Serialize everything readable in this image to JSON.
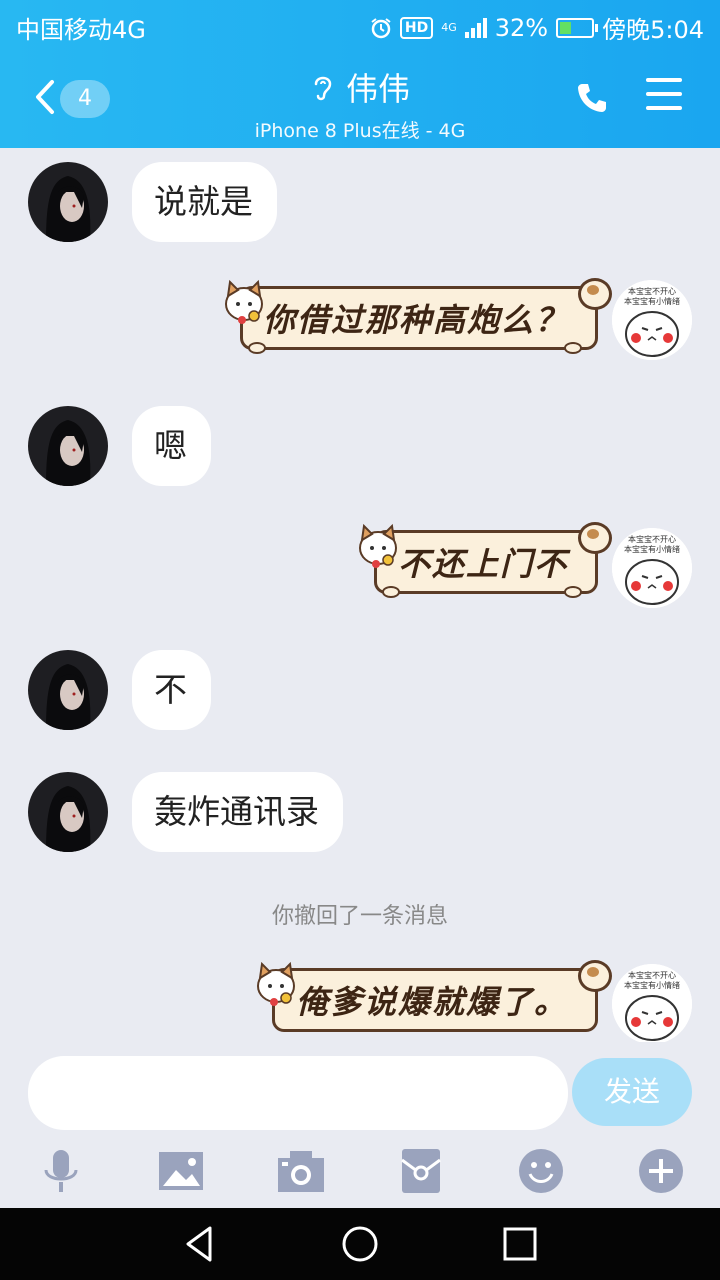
{
  "status_bar": {
    "carrier": "中国移动4G",
    "hd": "HD",
    "network": "4G",
    "battery": "32%",
    "time": "傍晚5:04"
  },
  "header": {
    "unread_count": "4",
    "contact_name": "伟伟",
    "subtitle": "iPhone 8 Plus在线 - 4G"
  },
  "messages": [
    {
      "side": "left",
      "type": "text",
      "text": "说就是"
    },
    {
      "side": "right",
      "type": "sticker",
      "text": "你借过那种高炮么？",
      "avatar_text": "本宝宝不开心\n本宝宝有小情绪"
    },
    {
      "side": "left",
      "type": "text",
      "text": "嗯"
    },
    {
      "side": "right",
      "type": "sticker",
      "text": "不还上门不",
      "avatar_text": "本宝宝不开心\n本宝宝有小情绪"
    },
    {
      "side": "left",
      "type": "text",
      "text": "不"
    },
    {
      "side": "left",
      "type": "text",
      "text": "轰炸通讯录"
    },
    {
      "side": "system",
      "type": "notice",
      "text": "你撤回了一条消息"
    },
    {
      "side": "right",
      "type": "sticker",
      "text": "俺爹说爆就爆了。",
      "avatar_text": "本宝宝不开心\n本宝宝有小情绪"
    }
  ],
  "input_bar": {
    "placeholder": "",
    "send_label": "发送"
  },
  "toolbar_icons": [
    "microphone-icon",
    "image-icon",
    "camera-icon",
    "red-packet-icon",
    "emoji-icon",
    "plus-icon"
  ],
  "colors": {
    "header": "#1aa6f0",
    "background": "#e9ebf2",
    "send_disabled": "#a9dff8"
  }
}
